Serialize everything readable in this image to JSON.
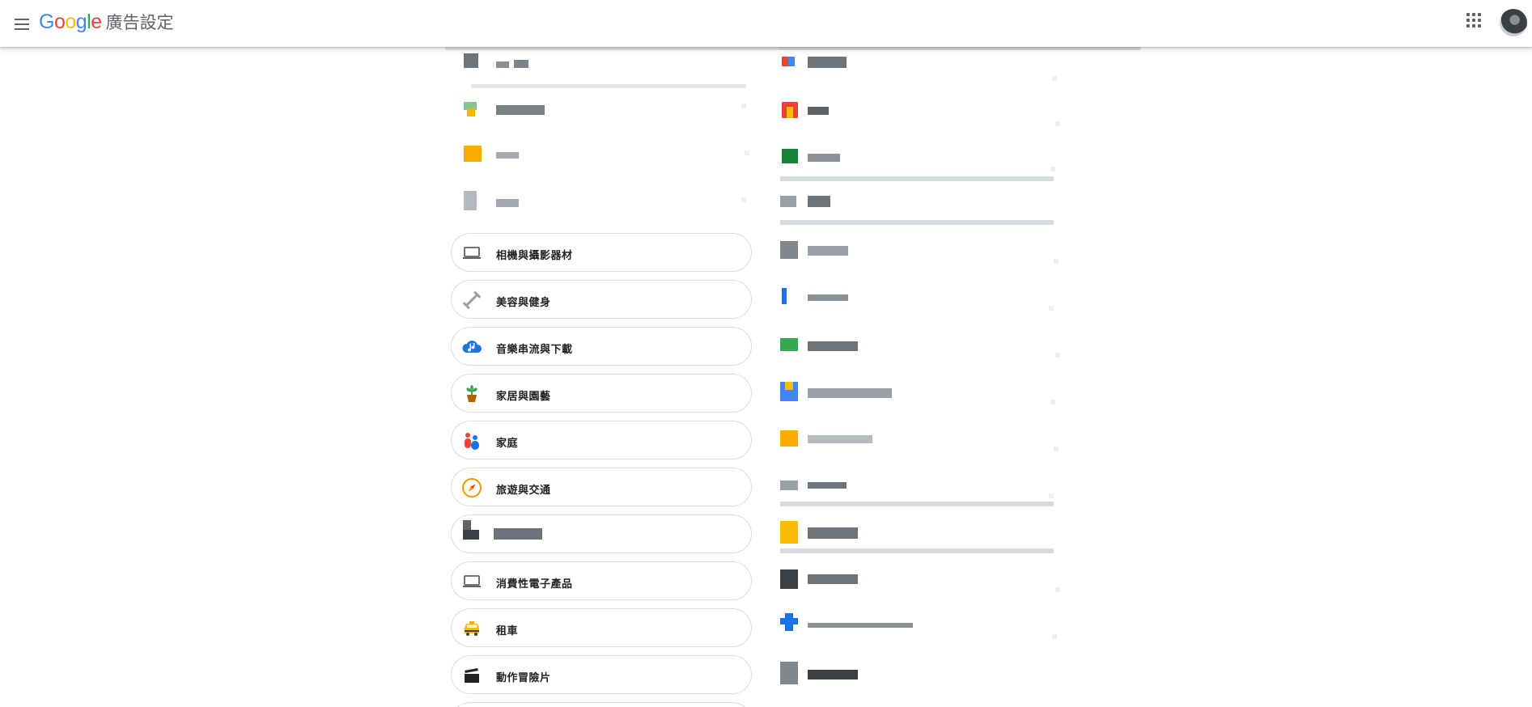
{
  "header": {
    "logo_text": [
      "G",
      "o",
      "o",
      "g",
      "l",
      "e"
    ],
    "title": "廣告設定",
    "menu_icon": "hamburger-menu-icon",
    "apps_icon": "google-apps-grid-icon",
    "avatar": "account-avatar"
  },
  "interests": {
    "left_column": [
      {
        "label": "相機與攝影器材",
        "icon": "laptop-icon"
      },
      {
        "label": "美容與健身",
        "icon": "dumbbell-icon"
      },
      {
        "label": "音樂串流與下載",
        "icon": "cloud-music-icon"
      },
      {
        "label": "家居與園藝",
        "icon": "potted-plant-icon"
      },
      {
        "label": "家庭",
        "icon": "family-icon"
      },
      {
        "label": "旅遊與交通",
        "icon": "compass-icon"
      },
      {
        "label": "消費性電子產品",
        "icon": "laptop-icon"
      },
      {
        "label": "租車",
        "icon": "taxi-icon"
      },
      {
        "label": "動作冒險片",
        "icon": "clapperboard-icon"
      }
    ]
  },
  "colors": {
    "google_blue": "#4285F4",
    "google_red": "#EA4335",
    "google_yellow": "#FBBC05",
    "google_green": "#34A853",
    "pill_border": "#dadce0"
  }
}
